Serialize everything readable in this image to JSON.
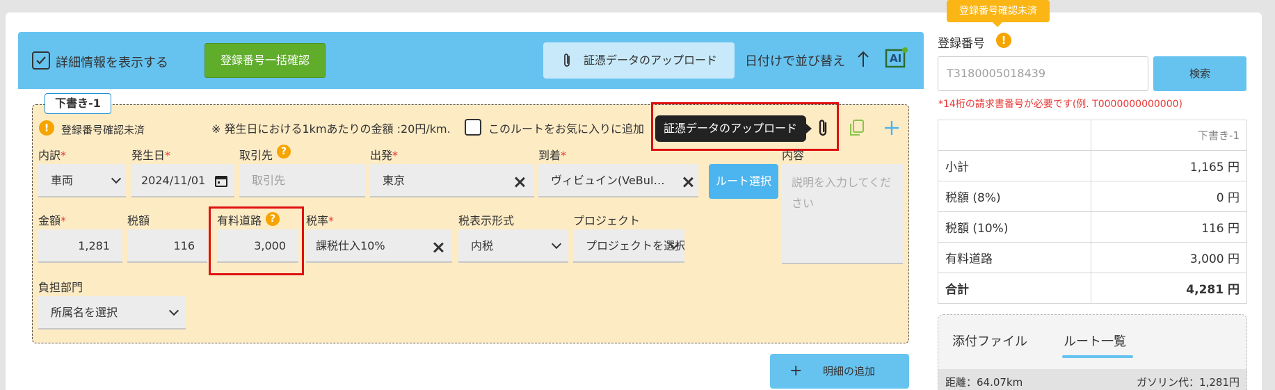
{
  "toolbar": {
    "show_details_label": "詳細情報を表示する",
    "bulk_confirm_label": "登録番号一括確認",
    "upload_label": "証憑データのアップロード",
    "sort_label": "日付けで並び替え",
    "ai_label": "AI"
  },
  "draft": {
    "tag": "下書き-1",
    "status": "登録番号確認未済",
    "rate_note": "※ 発生日における1kmあたりの金額 :20円/km.",
    "favorite_label": "このルートをお気に入りに追加",
    "tooltip": "証憑データのアップロード",
    "fields": {
      "breakdown": {
        "label": "内訳",
        "value": "車両"
      },
      "date": {
        "label": "発生日",
        "value": "2024/11/01"
      },
      "vendor": {
        "label": "取引先",
        "placeholder": "取引先"
      },
      "departure": {
        "label": "出発",
        "value": "東京"
      },
      "arrival": {
        "label": "到着",
        "value": "ヴィビュイン(VeBuIn)株式会"
      },
      "route_button": "ルート選択",
      "content": {
        "label": "内容",
        "placeholder": "説明を入力してください"
      },
      "amount": {
        "label": "金額",
        "value": "1,281"
      },
      "tax": {
        "label": "税額",
        "value": "116"
      },
      "toll": {
        "label": "有料道路",
        "value": "3,000"
      },
      "tax_rate": {
        "label": "税率",
        "value": "課税仕入10%"
      },
      "tax_display": {
        "label": "税表示形式",
        "value": "内税"
      },
      "project": {
        "label": "プロジェクト",
        "placeholder": "プロジェクトを選択"
      },
      "department": {
        "label": "負担部門",
        "placeholder": "所属名を選択"
      }
    },
    "add_detail_label": "明細の追加",
    "add_detail_icon": "+"
  },
  "registration": {
    "tip": "登録番号確認未済",
    "label": "登録番号",
    "placeholder": "T3180005018439",
    "search_label": "検索",
    "note": "*14桁の請求書番号が必要です(例. T0000000000000)"
  },
  "summary": {
    "header": "下書き-1",
    "rows": [
      {
        "label": "小計",
        "value": "1,165 円"
      },
      {
        "label": "税額 (8%)",
        "value": "0 円"
      },
      {
        "label": "税額 (10%)",
        "value": "116 円"
      },
      {
        "label": "有料道路",
        "value": "3,000 円"
      }
    ],
    "total": {
      "label": "合計",
      "value": "4,281 円"
    }
  },
  "tabs": {
    "items": [
      "添付ファイル",
      "ルート一覧"
    ],
    "active": 1,
    "distance": "距離：64.07km",
    "gas": "ガソリン代：1,281円"
  },
  "colors": {
    "toolbar": "#66c3f0",
    "green": "#5fad2b",
    "card": "#fdebc4",
    "warning": "#f5a400",
    "required": "#e53935",
    "highlight": "#e01010"
  }
}
